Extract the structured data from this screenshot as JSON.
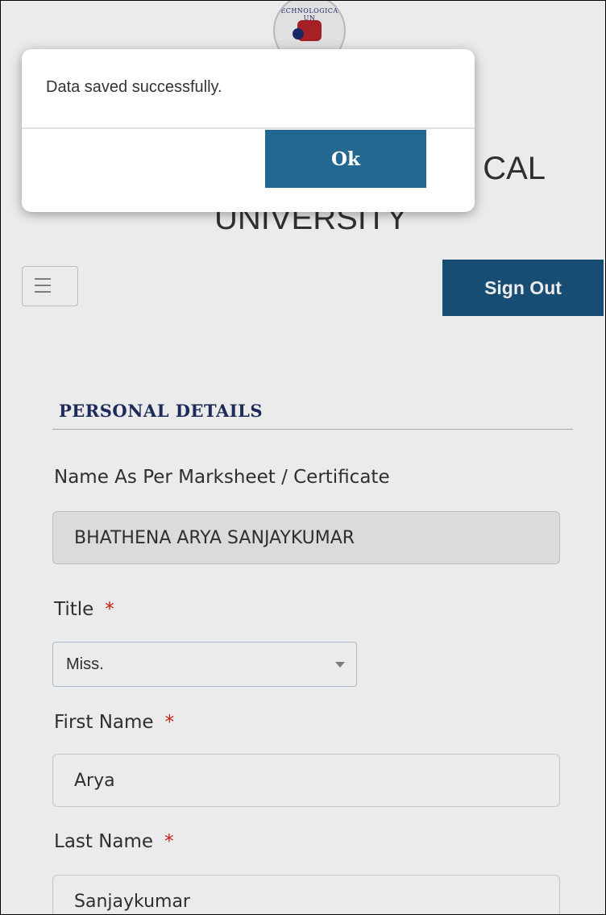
{
  "header": {
    "logo_ring_text": "TECHNOLOGICAL UN",
    "title_line1_visible": "CAL",
    "title_line2": "UNIVERSITY",
    "menu_icon": "hamburger-icon",
    "sign_out_label": "Sign Out"
  },
  "section": {
    "title": "PERSONAL DETAILS"
  },
  "form": {
    "name_label": "Name As Per Marksheet / Certificate",
    "name_value": "BHATHENA ARYA SANJAYKUMAR",
    "title_label": "Title",
    "title_required": "*",
    "title_value": "Miss.",
    "first_name_label": "First Name",
    "first_name_required": "*",
    "first_name_value": "Arya",
    "last_name_label": "Last Name",
    "last_name_required": "*",
    "last_name_value": "Sanjaykumar"
  },
  "dialog": {
    "message": "Data saved successfully.",
    "ok_label": "Ok"
  },
  "colors": {
    "primary_button": "#1a547c",
    "ok_button": "#236891",
    "section_title": "#1f2f62",
    "required_marker": "#d9221a"
  }
}
